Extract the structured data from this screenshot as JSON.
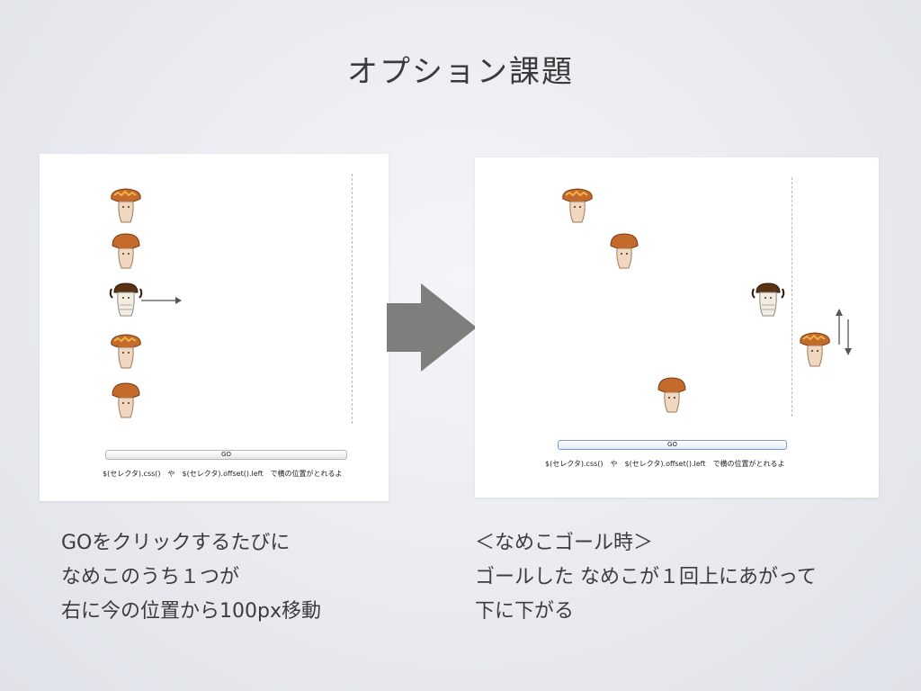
{
  "slide": {
    "title": "オプション課題"
  },
  "panels": {
    "left": {
      "go_label": "GO",
      "hint": "$(セレクタ).css()　や　$(セレクタ).offset().left　で横の位置がとれるよ"
    },
    "right": {
      "go_label": "GO",
      "hint": "$(セレクタ).css()　や　$(セレクタ).offset().left　で横の位置がとれるよ"
    }
  },
  "captions": {
    "left": [
      "GOをクリックするたびに",
      "なめこのうち１つが",
      "右に今の位置から100px移動"
    ],
    "right": [
      "＜なめこゴール時＞",
      "ゴールした なめこが１回上にあがって",
      "下に下がる"
    ]
  },
  "icons": {
    "nameko_ruffled": "nameko-ruffled-icon",
    "nameko_plain": "nameko-plain-icon",
    "nameko_hair": "nameko-hair-icon",
    "arrow_right": "arrow-right-icon",
    "arrow_updown": "arrow-up-down-icon"
  },
  "colors": {
    "cap_brown": "#c46a2a",
    "cap_dark": "#8a4416",
    "stem": "#f1d7bf",
    "big_arrow": "#7c7f7c"
  }
}
